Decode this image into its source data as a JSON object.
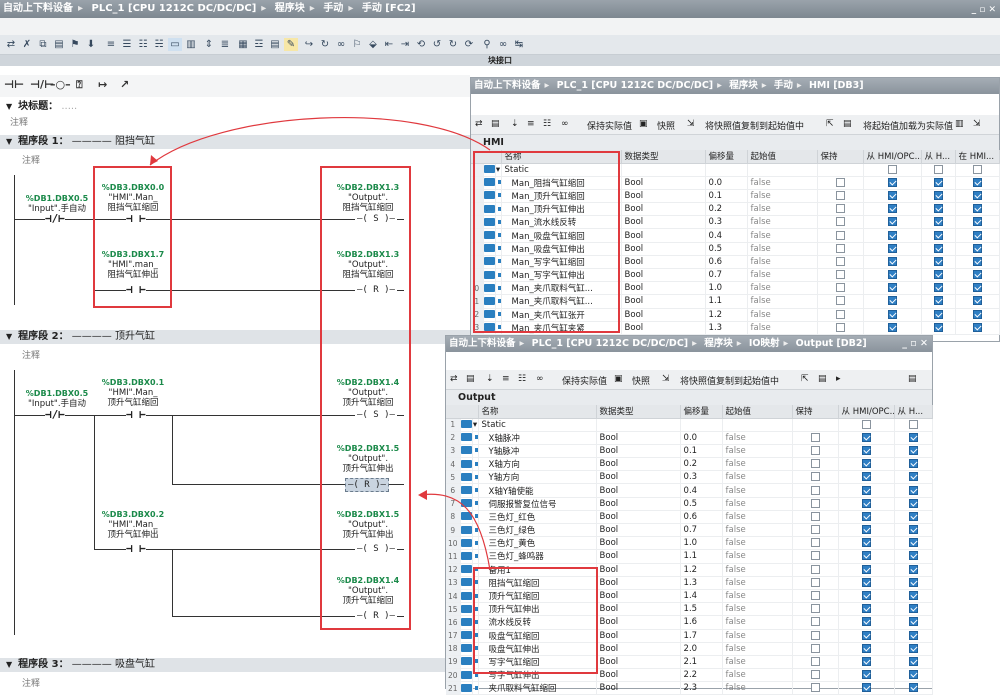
{
  "main_title": {
    "crumbs": [
      "自动上下料设备",
      "PLC_1 [CPU 1212C DC/DC/DC]",
      "程序块",
      "手动",
      "手动 [FC2]"
    ]
  },
  "interface_label": "块接口",
  "block_title": {
    "label": "块标题：",
    "comment": "注释"
  },
  "networks": [
    {
      "label": "程序段 1：",
      "title": "阻挡气缸",
      "comment": "注释"
    },
    {
      "label": "程序段 2：",
      "title": "顶升气缸",
      "comment": "注释"
    },
    {
      "label": "程序段 3：",
      "title": "吸盘气缸",
      "comment": "注释"
    }
  ],
  "ops": {
    "n1_in": {
      "addr": "%DB1.DBX0.5",
      "name": "\"Input\".手自动"
    },
    "n1_c1": {
      "addr": "%DB3.DBX0.0",
      "name1": "\"HMI\".Man_",
      "name2": "阻挡气缸缩回"
    },
    "n1_c2": {
      "addr": "%DB3.DBX1.7",
      "name1": "\"HMI\".man_",
      "name2": "阻挡气缸伸出"
    },
    "n1_q1": {
      "addr": "%DB2.DBX1.3",
      "name1": "\"Output\".",
      "name2": "阻挡气缸缩回",
      "coil": "S"
    },
    "n1_q2": {
      "addr": "%DB2.DBX1.3",
      "name1": "\"Output\".",
      "name2": "阻挡气缸缩回",
      "coil": "R"
    },
    "n2_in": {
      "addr": "%DB1.DBX0.5",
      "name": "\"Input\".手自动"
    },
    "n2_c1": {
      "addr": "%DB3.DBX0.1",
      "name1": "\"HMI\".Man_",
      "name2": "顶升气缸缩回"
    },
    "n2_c2": {
      "addr": "%DB3.DBX0.2",
      "name1": "\"HMI\".Man_",
      "name2": "顶升气缸伸出"
    },
    "n2_q1": {
      "addr": "%DB2.DBX1.4",
      "name1": "\"Output\".",
      "name2": "顶升气缸缩回",
      "coil": "S"
    },
    "n2_q2": {
      "addr": "%DB2.DBX1.5",
      "name1": "\"Output\".",
      "name2": "顶升气缸伸出",
      "coil": "R"
    },
    "n2_q3": {
      "addr": "%DB2.DBX1.5",
      "name1": "\"Output\".",
      "name2": "顶升气缸伸出",
      "coil": "S"
    },
    "n2_q4": {
      "addr": "%DB2.DBX1.4",
      "name1": "\"Output\".",
      "name2": "顶升气缸缩回",
      "coil": "R"
    }
  },
  "hmi_panel": {
    "crumbs": [
      "自动上下料设备",
      "PLC_1 [CPU 1212C DC/DC/DC]",
      "程序块",
      "手动",
      "HMI [DB3]"
    ],
    "toolbar": {
      "keep": "保持实际值",
      "snapshot": "快照",
      "copy": "将快照值复制到起始值中",
      "load": "将起始值加载为实际值"
    },
    "db_name": "HMI",
    "columns": [
      "名称",
      "数据类型",
      "偏移量",
      "起始值",
      "保持",
      "从 HMI/OPC...",
      "从 H...",
      "在 HMI..."
    ],
    "rows": [
      {
        "n": "",
        "name": "Static",
        "type": "",
        "off": "",
        "start": ""
      },
      {
        "n": "",
        "name": "Man_阻挡气缸缩回",
        "type": "Bool",
        "off": "0.0",
        "start": "false"
      },
      {
        "n": "",
        "name": "Man_顶升气缸缩回",
        "type": "Bool",
        "off": "0.1",
        "start": "false"
      },
      {
        "n": "",
        "name": "Man_顶升气缸伸出",
        "type": "Bool",
        "off": "0.2",
        "start": "false"
      },
      {
        "n": "",
        "name": "Man_流水线反转",
        "type": "Bool",
        "off": "0.3",
        "start": "false"
      },
      {
        "n": "",
        "name": "Man_吸盘气缸缩回",
        "type": "Bool",
        "off": "0.4",
        "start": "false"
      },
      {
        "n": "",
        "name": "Man_吸盘气缸伸出",
        "type": "Bool",
        "off": "0.5",
        "start": "false"
      },
      {
        "n": "",
        "name": "Man_写字气缸缩回",
        "type": "Bool",
        "off": "0.6",
        "start": "false"
      },
      {
        "n": "",
        "name": "Man_写字气缸伸出",
        "type": "Bool",
        "off": "0.7",
        "start": "false"
      },
      {
        "n": "0",
        "name": "Man_夹爪取料气缸...",
        "type": "Bool",
        "off": "1.0",
        "start": "false"
      },
      {
        "n": "1",
        "name": "Man_夹爪取料气缸...",
        "type": "Bool",
        "off": "1.1",
        "start": "false"
      },
      {
        "n": "2",
        "name": "Man_夹爪气缸张开",
        "type": "Bool",
        "off": "1.2",
        "start": "false"
      },
      {
        "n": "3",
        "name": "Man_夹爪气缸夹紧",
        "type": "Bool",
        "off": "1.3",
        "start": "false"
      }
    ]
  },
  "out_panel": {
    "crumbs": [
      "自动上下料设备",
      "PLC_1 [CPU 1212C DC/DC/DC]",
      "程序块",
      "IO映射",
      "Output [DB2]"
    ],
    "toolbar": {
      "keep": "保持实际值",
      "snapshot": "快照",
      "copy": "将快照值复制到起始值中"
    },
    "db_name": "Output",
    "columns": [
      "名称",
      "数据类型",
      "偏移量",
      "起始值",
      "保持",
      "从 HMI/OPC...",
      "从 H..."
    ],
    "rows": [
      {
        "n": "1",
        "name": "Static",
        "type": "",
        "off": "",
        "start": ""
      },
      {
        "n": "2",
        "name": "X轴脉冲",
        "type": "Bool",
        "off": "0.0",
        "start": "false"
      },
      {
        "n": "3",
        "name": "Y轴脉冲",
        "type": "Bool",
        "off": "0.1",
        "start": "false"
      },
      {
        "n": "4",
        "name": "X轴方向",
        "type": "Bool",
        "off": "0.2",
        "start": "false"
      },
      {
        "n": "5",
        "name": "Y轴方向",
        "type": "Bool",
        "off": "0.3",
        "start": "false"
      },
      {
        "n": "6",
        "name": "X轴Y轴使能",
        "type": "Bool",
        "off": "0.4",
        "start": "false"
      },
      {
        "n": "7",
        "name": "伺服报警复位信号",
        "type": "Bool",
        "off": "0.5",
        "start": "false"
      },
      {
        "n": "8",
        "name": "三色灯_红色",
        "type": "Bool",
        "off": "0.6",
        "start": "false"
      },
      {
        "n": "9",
        "name": "三色灯_绿色",
        "type": "Bool",
        "off": "0.7",
        "start": "false"
      },
      {
        "n": "10",
        "name": "三色灯_黄色",
        "type": "Bool",
        "off": "1.0",
        "start": "false"
      },
      {
        "n": "11",
        "name": "三色灯_蜂鸣器",
        "type": "Bool",
        "off": "1.1",
        "start": "false"
      },
      {
        "n": "12",
        "name": "备用1",
        "type": "Bool",
        "off": "1.2",
        "start": "false"
      },
      {
        "n": "13",
        "name": "阻挡气缸缩回",
        "type": "Bool",
        "off": "1.3",
        "start": "false"
      },
      {
        "n": "14",
        "name": "顶升气缸缩回",
        "type": "Bool",
        "off": "1.4",
        "start": "false"
      },
      {
        "n": "15",
        "name": "顶升气缸伸出",
        "type": "Bool",
        "off": "1.5",
        "start": "false"
      },
      {
        "n": "16",
        "name": "流水线反转",
        "type": "Bool",
        "off": "1.6",
        "start": "false"
      },
      {
        "n": "17",
        "name": "吸盘气缸缩回",
        "type": "Bool",
        "off": "1.7",
        "start": "false"
      },
      {
        "n": "18",
        "name": "吸盘气缸伸出",
        "type": "Bool",
        "off": "2.0",
        "start": "false"
      },
      {
        "n": "19",
        "name": "写字气缸缩回",
        "type": "Bool",
        "off": "2.1",
        "start": "false"
      },
      {
        "n": "20",
        "name": "写字气缸伸出",
        "type": "Bool",
        "off": "2.2",
        "start": "false"
      },
      {
        "n": "21",
        "name": "夹爪取料气缸缩回",
        "type": "Bool",
        "off": "2.3",
        "start": "false"
      }
    ]
  },
  "colors": {
    "accent": "#2f7fc4",
    "highlight": "#e0393e",
    "address": "#1b8a4a"
  }
}
